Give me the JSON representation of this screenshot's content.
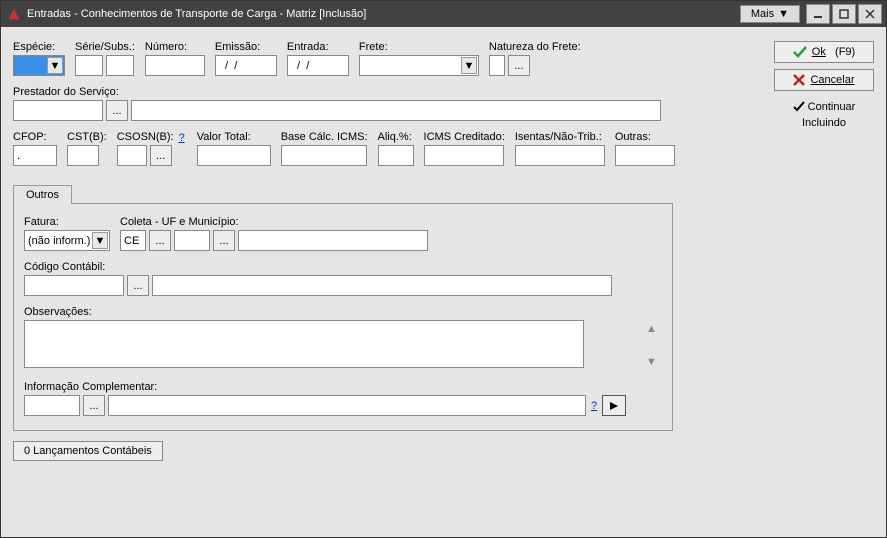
{
  "titlebar": {
    "title": "Entradas - Conhecimentos de Transporte de Carga - Matriz [Inclusão]",
    "mais": "Mais"
  },
  "labels": {
    "especie": "Espécie:",
    "serie": "Série/Subs.:",
    "numero": "Número:",
    "emissao": "Emissão:",
    "entrada": "Entrada:",
    "frete": "Frete:",
    "natureza": "Natureza do Frete:",
    "prestador": "Prestador do Serviço:",
    "cfop": "CFOP:",
    "cstb": "CST(B):",
    "csosnb": "CSOSN(B):",
    "valortotal": "Valor Total:",
    "basecalc": "Base Cálc. ICMS:",
    "aliq": "Aliq.%:",
    "icmscred": "ICMS Creditado:",
    "isentas": "Isentas/Não-Trib.:",
    "outras": "Outras:",
    "tab_outros": "Outros",
    "fatura": "Fatura:",
    "coleta": "Coleta - UF e Município:",
    "codcontabil": "Código Contábil:",
    "obs": "Observações:",
    "infocomp": "Informação Complementar:",
    "lanc": "0 Lançamentos Contábeis"
  },
  "values": {
    "emissao": "  /  /",
    "entrada": "  /  /",
    "cfop": ".",
    "fatura_sel": "(não inform.)",
    "uf": "CE"
  },
  "buttons": {
    "ok": "Ok",
    "ok_key": "(F9)",
    "cancel": "Cancelar",
    "continue1": "Continuar",
    "continue2": "Incluindo"
  }
}
